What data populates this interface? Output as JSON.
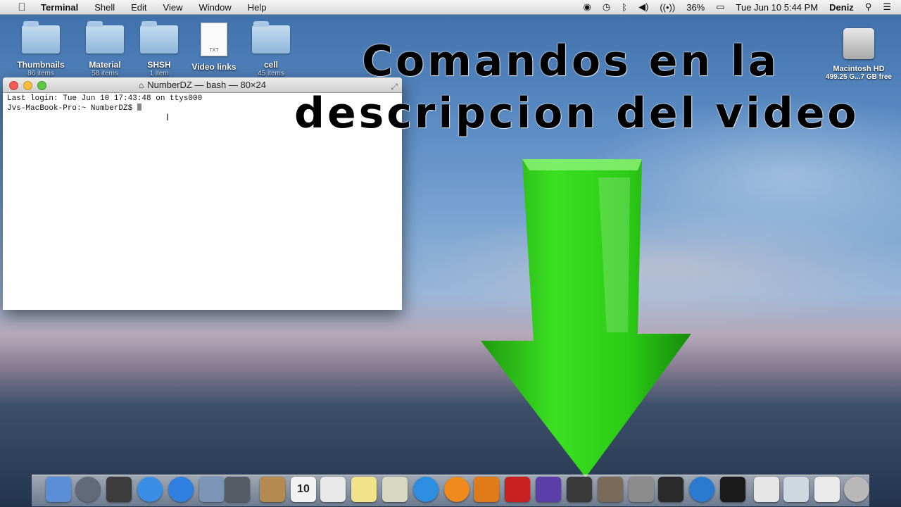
{
  "menubar": {
    "apple": "",
    "app_name": "Terminal",
    "menus": [
      "Shell",
      "Edit",
      "View",
      "Window",
      "Help"
    ],
    "battery": "36%",
    "datetime": "Tue Jun 10  5:44 PM",
    "user": "Deniz"
  },
  "desktop": {
    "icons": [
      {
        "name": "Thumbnails",
        "sub": "86 items"
      },
      {
        "name": "Material",
        "sub": "58 items"
      },
      {
        "name": "SHSH",
        "sub": "1 item"
      },
      {
        "name": "Video links",
        "sub": "",
        "doc_label": "TXT"
      },
      {
        "name": "cell",
        "sub": "45 items"
      }
    ],
    "drive": {
      "name": "Macintosh HD",
      "sub": "499.25 G...7 GB free"
    }
  },
  "terminal": {
    "title": "NumberDZ — bash — 80×24",
    "lines": [
      "Last login: Tue Jun 10 17:43:48 on ttys000",
      "Jvs-MacBook-Pro:~ NumberDZ$ "
    ]
  },
  "overlay": {
    "line1": "Comandos en la",
    "line2": "descripcion del video"
  },
  "colors": {
    "arrow": "#2ecc1a",
    "arrow_dark": "#14870a"
  },
  "dock": {
    "apps": [
      {
        "icon": "finder-icon",
        "color": "#5a8fd8"
      },
      {
        "icon": "launchpad-icon",
        "color": "#606a78"
      },
      {
        "icon": "mission-control-icon",
        "color": "#3c3c3c"
      },
      {
        "icon": "safari-icon",
        "color": "#3a8ee6"
      },
      {
        "icon": "app-store-icon",
        "color": "#2f7fe0"
      },
      {
        "icon": "preview-icon",
        "color": "#7c95b6"
      },
      {
        "icon": "facetime-icon",
        "color": "#555c66"
      },
      {
        "icon": "contacts-icon",
        "color": "#b58a50"
      },
      {
        "icon": "calendar-icon",
        "color": "#f2f2f2",
        "label": "10"
      },
      {
        "icon": "reminders-icon",
        "color": "#e8e8e8"
      },
      {
        "icon": "notes-icon",
        "color": "#f2e38a"
      },
      {
        "icon": "photos-icon",
        "color": "#d8d8c0"
      },
      {
        "icon": "itunes-icon",
        "color": "#2d8de0"
      },
      {
        "icon": "ibooks-icon",
        "color": "#f08a1c"
      },
      {
        "icon": "audacity-icon",
        "color": "#e07b1a"
      },
      {
        "icon": "photo-booth-icon",
        "color": "#c82020"
      },
      {
        "icon": "imovie-icon",
        "color": "#5b3ea8"
      },
      {
        "icon": "final-cut-icon",
        "color": "#3a3a3a"
      },
      {
        "icon": "image-capture-icon",
        "color": "#7a6a5a"
      },
      {
        "icon": "system-preferences-icon",
        "color": "#8c8c8c"
      },
      {
        "icon": "activity-monitor-icon",
        "color": "#2a2a2a"
      },
      {
        "icon": "quicktime-icon",
        "color": "#2a7ad0"
      },
      {
        "icon": "terminal-icon",
        "color": "#1a1a1a"
      },
      {
        "icon": "documents-stack-icon",
        "color": "#e6e6e6"
      },
      {
        "icon": "image-stack-icon",
        "color": "#cfd8e0"
      },
      {
        "icon": "downloads-stack-icon",
        "color": "#eaeaea"
      },
      {
        "icon": "trash-icon",
        "color": "#b8b8b8"
      }
    ]
  }
}
